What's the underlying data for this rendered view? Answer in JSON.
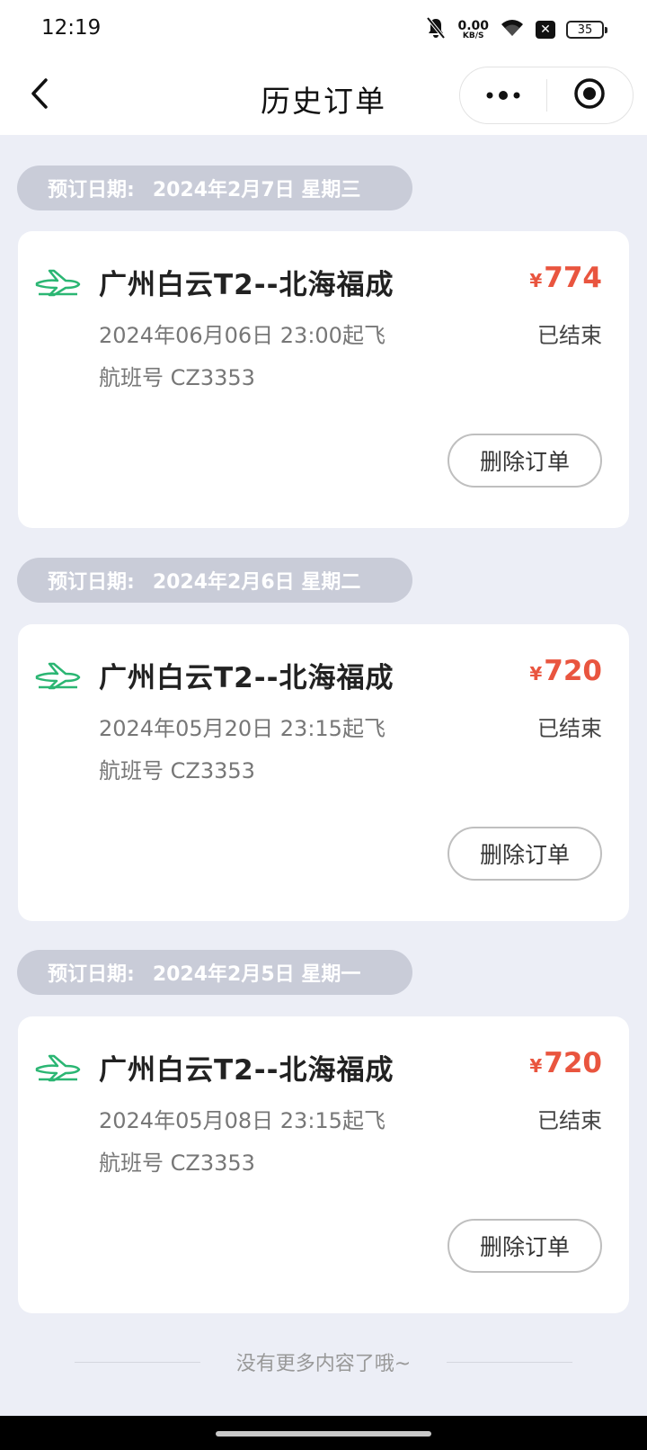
{
  "status_bar": {
    "time": "12:19",
    "net_speed_value": "0.00",
    "net_speed_unit": "KB/S",
    "battery": "35",
    "sim_label": "✕"
  },
  "nav": {
    "title": "历史订单"
  },
  "orders": [
    {
      "booking_label": "预订日期:",
      "booking_date": "2024年2月7日  星期三",
      "route": "广州白云T2--北海福成",
      "currency": "¥",
      "price": "774",
      "departure": "2024年06月06日 23:00起飞",
      "status": "已结束",
      "flight_no": "航班号 CZ3353",
      "delete_label": "删除订单"
    },
    {
      "booking_label": "预订日期:",
      "booking_date": "2024年2月6日  星期二",
      "route": "广州白云T2--北海福成",
      "currency": "¥",
      "price": "720",
      "departure": "2024年05月20日 23:15起飞",
      "status": "已结束",
      "flight_no": "航班号 CZ3353",
      "delete_label": "删除订单"
    },
    {
      "booking_label": "预订日期:",
      "booking_date": "2024年2月5日  星期一",
      "route": "广州白云T2--北海福成",
      "currency": "¥",
      "price": "720",
      "departure": "2024年05月08日 23:15起飞",
      "status": "已结束",
      "flight_no": "航班号 CZ3353",
      "delete_label": "删除订单"
    }
  ],
  "footer": {
    "no_more": "没有更多内容了哦~"
  },
  "colors": {
    "accent_price": "#e9553f",
    "plane_icon": "#2bb673",
    "page_bg": "#eceef6",
    "date_pill_bg": "#c9ccd8"
  },
  "icons": {
    "back": "back-arrow-icon",
    "more": "more-dots-icon",
    "close_target": "target-circle-icon",
    "plane": "airplane-icon",
    "mute": "bell-off-icon",
    "wifi": "wifi-icon"
  }
}
